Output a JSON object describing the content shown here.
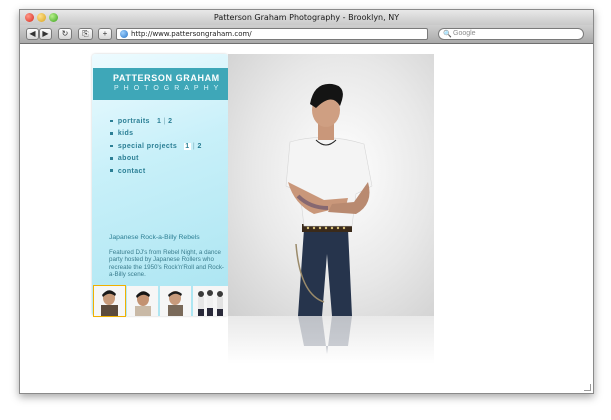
{
  "window": {
    "title": "Patterson Graham Photography - Brooklyn, NY",
    "url": "http://www.pattersongraham.com/",
    "search_placeholder": "Google"
  },
  "toolbar": {
    "back_label": "◀",
    "forward_label": "▶",
    "reload_label": "↻",
    "snapshot_label": "⎘",
    "add_label": "+"
  },
  "logo": {
    "name": "PATTERSON GRAHAM",
    "subtitle": "PHOTOGRAPHY"
  },
  "nav": {
    "portraits": {
      "label": "portraits",
      "page1": "1",
      "sep": "|",
      "page2": "2"
    },
    "kids": {
      "label": "kids"
    },
    "special_projects": {
      "label": "special projects",
      "page1": "1",
      "sep": "|",
      "page2": "2"
    },
    "about": {
      "label": "about"
    },
    "contact": {
      "label": "contact"
    }
  },
  "project": {
    "title": "Japanese Rock-a-Billy Rebels",
    "description": "Featured DJ's from Rebel Night, a dance party hosted by Japanese Rollers who recreate the 1950's Rock'n'Roll and Rock-a-Billy scene."
  },
  "colors": {
    "accent": "#3ea7b8",
    "nav_text": "#2b7f95",
    "sidebar_light": "#eefbff",
    "sidebar_dark": "#a9e4f1"
  }
}
